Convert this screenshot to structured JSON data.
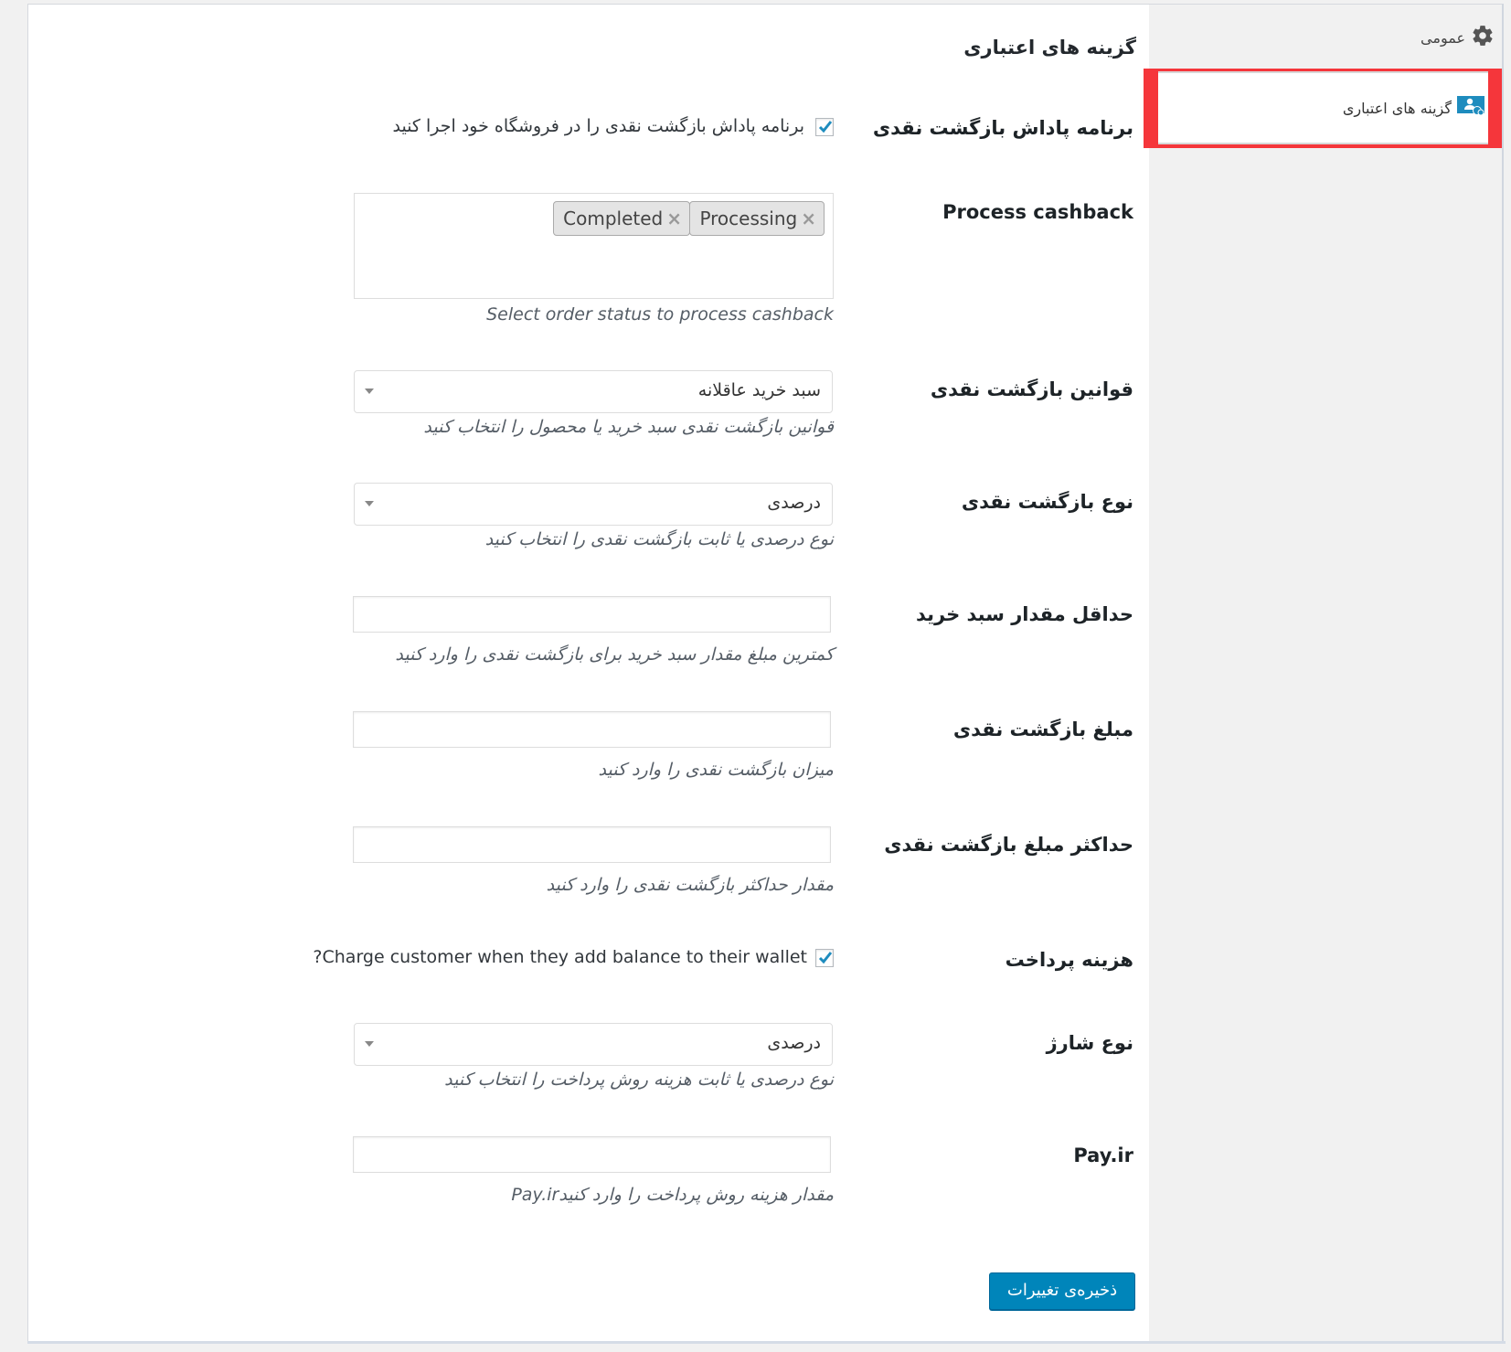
{
  "sidebar": {
    "items": [
      {
        "label": "عمومی",
        "icon": "gear-icon",
        "active": false
      },
      {
        "label": "گزینه های اعتباری",
        "icon": "user-credit-icon",
        "active": true
      }
    ],
    "highlight_color": "#f5363b"
  },
  "main": {
    "title": "گزینه های اعتباری",
    "fields": {
      "cashback_program": {
        "label": "برنامه پاداش بازگشت نقدی",
        "checkbox_label": "برنامه پاداش بازگشت نقدی را در فروشگاه خود اجرا کنید",
        "checked": true
      },
      "process_cashback": {
        "label": "Process cashback",
        "tags": [
          {
            "label": "Processing",
            "remove": "×"
          },
          {
            "label": "Completed",
            "remove": "×"
          }
        ],
        "help": "Select order status to process cashback"
      },
      "cashback_rules": {
        "label": "قوانین بازگشت نقدی",
        "value": "سبد خرید عاقلانه",
        "help": "قوانین بازگشت نقدی سبد خرید یا محصول را انتخاب کنید"
      },
      "cashback_type": {
        "label": "نوع بازگشت نقدی",
        "value": "درصدی",
        "help": "نوع درصدی یا ثابت بازگشت نقدی را انتخاب کنید"
      },
      "min_cart_amount": {
        "label": "حداقل مقدار سبد خرید",
        "value": "",
        "help": "کمترین مبلغ مقدار سبد خرید برای بازگشت نقدی را وارد کنید"
      },
      "cashback_amount": {
        "label": "مبلغ بازگشت نقدی",
        "value": "",
        "help": "میزان بازگشت نقدی را وارد کنید"
      },
      "max_cashback_amount": {
        "label": "حداکثر مبلغ بازگشت نقدی",
        "value": "",
        "help": "مقدار حداکثر بازگشت نقدی را وارد کنید"
      },
      "payment_fee": {
        "label": "هزینه پرداخت",
        "checkbox_label": "Charge customer when they add balance to their wallet?",
        "checked": true
      },
      "charge_type": {
        "label": "نوع شارژ",
        "value": "درصدی",
        "help": "نوع درصدی یا ثابت هزینه روش پرداخت را انتخاب کنید"
      },
      "payir": {
        "label": "Pay.ir",
        "value": "",
        "help": "مقدار هزینه روش پرداخت را وارد کنیدPay.ir"
      }
    },
    "save_label": "ذخیره‌ی تغییرات",
    "accent_color": "#0085ba"
  }
}
